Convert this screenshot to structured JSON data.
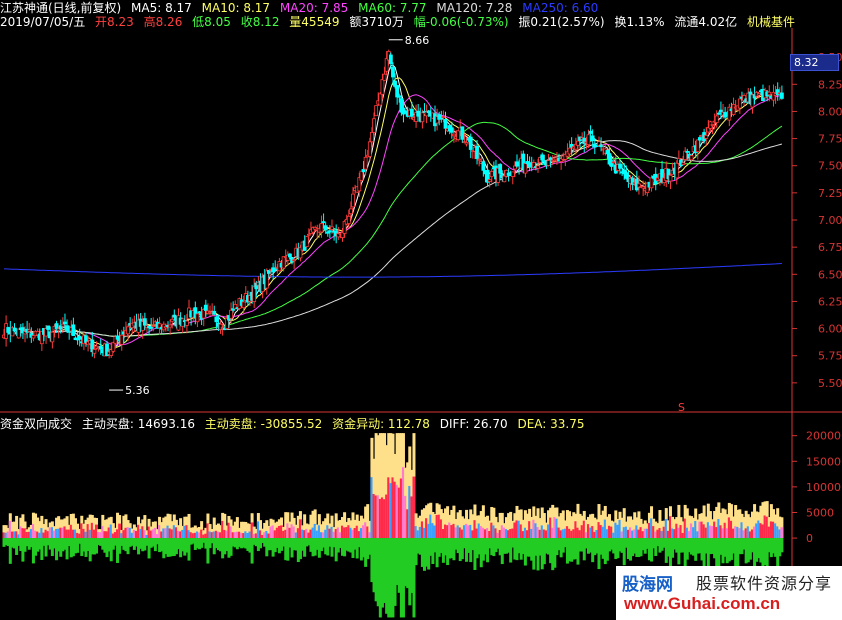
{
  "header": {
    "stock": "江苏神通(日线,前复权)",
    "ma5": {
      "label": "MA5: 8.17",
      "color": "#ffffff"
    },
    "ma10": {
      "label": "MA10: 8.17",
      "color": "#ffff66"
    },
    "ma20": {
      "label": "MA20: 7.85",
      "color": "#ff44ff"
    },
    "ma60": {
      "label": "MA60: 7.77",
      "color": "#44ff44"
    },
    "ma120": {
      "label": "MA120: 7.28",
      "color": "#dddddd"
    },
    "ma250": {
      "label": "MA250: 6.60",
      "color": "#2a3cff"
    }
  },
  "quote": {
    "date": "2019/07/05/五",
    "open": "开8.23",
    "high": "高8.26",
    "low": "低8.05",
    "close": "收8.12",
    "volume": "量45549",
    "amount": "额3710万",
    "change": "幅-0.06(-0.73%)",
    "amplitude": "振0.21(2.57%)",
    "turnover": "换1.13%",
    "float": "流通4.02亿",
    "sector": "机械基件"
  },
  "indicator": {
    "name": "资金双向成交",
    "buy": "主动买盘: 14693.16",
    "sell": "主动卖盘: -30855.52",
    "anomaly": "资金异动: 112.78",
    "diff": "DIFF: 26.70",
    "dea": "DEA: 33.75"
  },
  "last_price": "8.32",
  "high_marker": "8.66",
  "low_marker": "5.36",
  "signal_marker": "S",
  "watermark": {
    "logo": "股海网",
    "slogan": "股票软件资源分享",
    "url": "www.Guhai.com.cn"
  },
  "colors": {
    "up": "#ff3a3a",
    "down": "#00ffff",
    "axis": "#d83434",
    "vol_pos": "#ffe08a",
    "vol_neg": "#22cc22"
  },
  "chart_data": [
    {
      "type": "candlestick",
      "name": "price",
      "yticks": [
        5.5,
        5.75,
        6.0,
        6.25,
        6.5,
        6.75,
        7.0,
        7.25,
        7.5,
        7.75,
        8.0,
        8.25,
        8.5
      ],
      "ylim": [
        5.25,
        8.75
      ],
      "markers": {
        "high": 8.66,
        "low": 5.36,
        "last": 8.32
      },
      "keypoints": [
        [
          0,
          6.0
        ],
        [
          10,
          5.95
        ],
        [
          20,
          5.95
        ],
        [
          30,
          6.0
        ],
        [
          40,
          5.85
        ],
        [
          50,
          5.8
        ],
        [
          60,
          6.05
        ],
        [
          70,
          6.0
        ],
        [
          80,
          6.05
        ],
        [
          90,
          6.15
        ],
        [
          100,
          6.1
        ],
        [
          105,
          6.05
        ],
        [
          110,
          6.2
        ],
        [
          120,
          6.35
        ],
        [
          130,
          6.6
        ],
        [
          140,
          6.7
        ],
        [
          150,
          6.95
        ],
        [
          160,
          6.85
        ],
        [
          170,
          7.4
        ],
        [
          175,
          7.8
        ],
        [
          180,
          8.3
        ],
        [
          183,
          8.55
        ],
        [
          186,
          8.2
        ],
        [
          190,
          8.0
        ],
        [
          200,
          7.95
        ],
        [
          210,
          7.9
        ],
        [
          220,
          7.75
        ],
        [
          230,
          7.4
        ],
        [
          240,
          7.45
        ],
        [
          250,
          7.55
        ],
        [
          260,
          7.5
        ],
        [
          270,
          7.65
        ],
        [
          280,
          7.75
        ],
        [
          290,
          7.5
        ],
        [
          300,
          7.3
        ],
        [
          310,
          7.35
        ],
        [
          320,
          7.5
        ],
        [
          330,
          7.7
        ],
        [
          340,
          7.95
        ],
        [
          350,
          8.1
        ],
        [
          360,
          8.15
        ],
        [
          370,
          8.12
        ]
      ]
    },
    {
      "type": "bar",
      "name": "资金双向成交",
      "yticks": [
        0,
        5000,
        10000,
        15000,
        20000
      ],
      "ylim": [
        -16000,
        21500
      ]
    }
  ]
}
